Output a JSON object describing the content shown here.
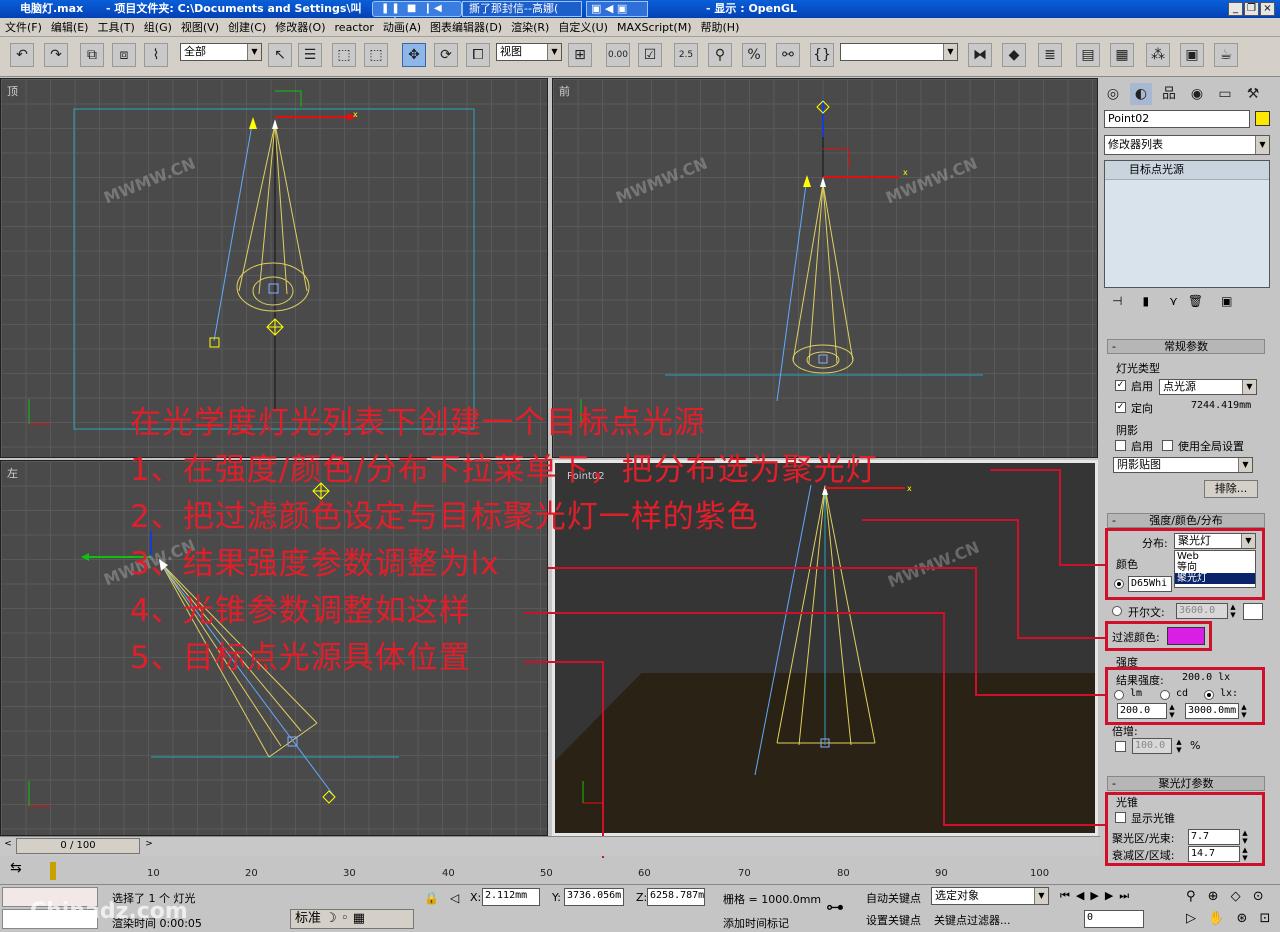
{
  "window": {
    "file_title": "电脑灯.max",
    "project_title": "- 项目文件夹: C:\\Documents and Settings\\叫",
    "display_title": "- 显示 : OpenGL",
    "task_media": "❚❚ ■ ❙◀ ▶❙ ◀ ▾",
    "task_chat": "撕了那封信--高娜(",
    "task_3": "▣ ◀ ▣"
  },
  "menu": [
    "文件(F)",
    "编辑(E)",
    "工具(T)",
    "组(G)",
    "视图(V)",
    "创建(C)",
    "修改器(O)",
    "reactor",
    "动画(A)",
    "图表编辑器(D)",
    "渲染(R)",
    "自定义(U)",
    "MAXScript(M)",
    "帮助(H)"
  ],
  "toolbar": {
    "selection_filter": "全部",
    "ref_coord": "视图",
    "percent_snap": "0.00",
    "angle_snap": "2.5",
    "named_sel": ""
  },
  "viewports": {
    "top": "顶",
    "front": "前",
    "left": "左",
    "front_tag": "Point02",
    "watermark": "MWMW.CN"
  },
  "annotation": {
    "title": "在光学度灯光列表下创建一个目标点光源",
    "steps": [
      "1、在强度/颜色/分布下拉菜单下，把分布选为聚光灯",
      "2、把过滤颜色设定与目标聚光灯一样的紫色",
      "3、结果强度参数调整为lx",
      "4、光锥参数调整如这样",
      "5、目标点光源具体位置"
    ],
    "color": "#e11f2a"
  },
  "cmd": {
    "object_name": "Point02",
    "object_color": "#ffe600",
    "modifier_list": "修改器列表",
    "stack_item": "目标点光源",
    "general": {
      "header": "常规参数",
      "light_type": "灯光类型",
      "enable": "启用",
      "type_value": "点光源",
      "targeted": "定向",
      "target_distance": "7244.419mm",
      "shadows": "阴影",
      "shadow_enable": "启用",
      "use_global": "使用全局设置",
      "shadow_type": "阴影贴图",
      "exclude": "排除..."
    },
    "intensity": {
      "header": "强度/颜色/分布",
      "distribution_label": "分布:",
      "distribution_value": "聚光灯",
      "options": [
        "Web",
        "等向",
        "聚光灯"
      ],
      "color_label": "颜色",
      "color_value": "D65Whi",
      "kelvin_label": "开尔文:",
      "kelvin_value": "3600.0",
      "filter_label": "过滤颜色:",
      "filter_color": "#d81fe6",
      "intensity_label": "强度",
      "result_label": "结果强度:",
      "result_value": "200.0 lx",
      "unit_lm": "lm",
      "unit_cd": "cd",
      "unit_lx": "lx:",
      "value": "200.0",
      "distance": "3000.0mm",
      "multiplier_label": "倍增:",
      "multiplier_value": "100.0",
      "percent": "%"
    },
    "spot": {
      "header": "聚光灯参数",
      "cone": "光锥",
      "show_cone": "显示光锥",
      "hotspot_label": "聚光区/光束:",
      "hotspot": "7.7",
      "falloff_label": "衰减区/区域:",
      "falloff": "14.7"
    }
  },
  "timeline": {
    "frame": "0 / 100",
    "ticks": [
      "10",
      "20",
      "30",
      "40",
      "50",
      "60",
      "70",
      "80",
      "90",
      "100"
    ]
  },
  "status": {
    "selected": "选择了 1 个 灯光",
    "render_time": "渲染时间  0:00:05",
    "x": "2.112mm",
    "y": "3736.056m",
    "z": "6258.787m",
    "grid": "栅格 = 1000.0mm",
    "add_time_tag": "添加时间标记",
    "auto_key": "自动关键点",
    "set_key": "设置关键点",
    "selected_object": "选定对象",
    "key_filters": "关键点过滤器...",
    "frame_field": "0",
    "ime": "标准",
    "watermark": "Chinadz.com"
  }
}
